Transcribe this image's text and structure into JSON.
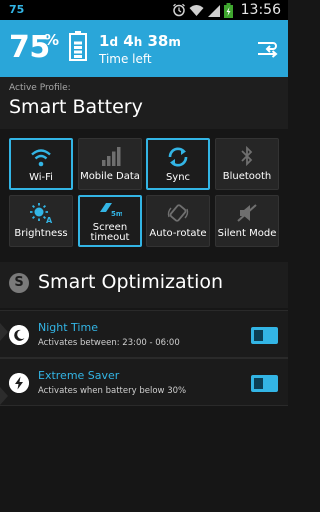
{
  "status_bar": {
    "left_text": "75",
    "time": "13:56",
    "icons": [
      "alarm-icon",
      "wifi-icon",
      "signal-icon",
      "battery-charging-icon"
    ]
  },
  "header": {
    "percent": "75",
    "percent_sign": "%",
    "time_left": {
      "days": "1",
      "days_unit": "d",
      "hours": "4",
      "hours_unit": "h",
      "minutes": "38",
      "minutes_unit": "m"
    },
    "time_left_label": "Time left",
    "battery_level": 0.75
  },
  "profile": {
    "label": "Active Profile:",
    "name": "Smart Battery"
  },
  "toggles": [
    {
      "label": "Wi-Fi",
      "icon": "wifi-icon",
      "on": true
    },
    {
      "label": "Mobile Data",
      "icon": "signal-bars-icon",
      "on": false
    },
    {
      "label": "Sync",
      "icon": "sync-icon",
      "on": true
    },
    {
      "label": "Bluetooth",
      "icon": "bluetooth-icon",
      "on": false
    },
    {
      "label": "Brightness",
      "icon": "brightness-auto-icon",
      "on": false
    },
    {
      "label": "Screen timeout",
      "label_line1": "Screen",
      "label_line2": "timeout",
      "icon": "screen-timeout-icon",
      "icon_text": "5m",
      "on": true
    },
    {
      "label": "Auto-rotate",
      "icon": "rotate-icon",
      "on": false
    },
    {
      "label": "Silent Mode",
      "icon": "silent-icon",
      "on": false
    }
  ],
  "section": {
    "badge": "S",
    "title": "Smart Optimization"
  },
  "rows": [
    {
      "title": "Night Time",
      "subtitle": "Activates between: 23:00 - 06:00",
      "icon": "moon-icon",
      "enabled": true
    },
    {
      "title": "Extreme Saver",
      "subtitle": "Activates when battery below 30%",
      "icon": "lightning-icon",
      "enabled": true
    }
  ],
  "colors": {
    "accent": "#33b5e5",
    "header_bg": "#2aa6d9",
    "background": "#161616"
  }
}
